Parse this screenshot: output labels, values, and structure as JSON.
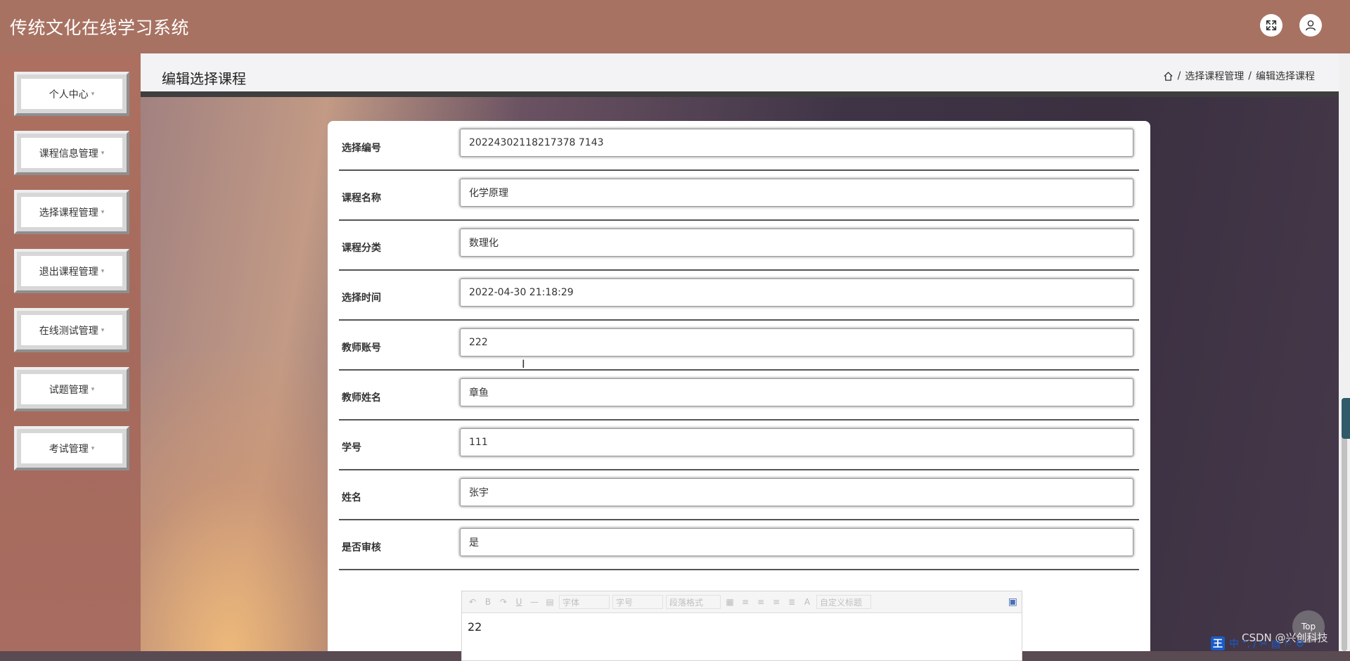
{
  "app": {
    "title": "传统文化在线学习系统"
  },
  "header": {
    "fullscreen_icon": "expand-icon",
    "user_icon": "user-icon"
  },
  "sidebar": {
    "items": [
      {
        "label": "个人中心"
      },
      {
        "label": "课程信息管理"
      },
      {
        "label": "选择课程管理"
      },
      {
        "label": "退出课程管理"
      },
      {
        "label": "在线测试管理"
      },
      {
        "label": "试题管理"
      },
      {
        "label": "考试管理"
      }
    ],
    "caret": "▾"
  },
  "page": {
    "title": "编辑选择课程",
    "breadcrumb": {
      "sep": "/",
      "item1": "选择课程管理",
      "item2": "编辑选择课程"
    }
  },
  "form": {
    "fields": [
      {
        "label": "选择编号",
        "value": "20224302118217378 7143"
      },
      {
        "label": "课程名称",
        "value": "化学原理"
      },
      {
        "label": "课程分类",
        "value": "数理化"
      },
      {
        "label": "选择时间",
        "value": "2022-04-30 21:18:29"
      },
      {
        "label": "教师账号",
        "value": "222"
      },
      {
        "label": "教师姓名",
        "value": "章鱼"
      },
      {
        "label": "学号",
        "value": "111"
      },
      {
        "label": "姓名",
        "value": "张宇"
      },
      {
        "label": "是否审核",
        "value": "是"
      }
    ]
  },
  "editor": {
    "toolbar": {
      "undo": "↶",
      "bold": "B",
      "redo": "↷",
      "underline": "U",
      "hr": "—",
      "doc": "▤",
      "font": "字体",
      "size": "字号",
      "paragraph": "段落格式",
      "table": "▦",
      "align_left": "≡",
      "align_center": "≡",
      "align_right": "≡",
      "justify": "≣",
      "color": "A",
      "custom_title": "自定义标题",
      "fullscreen": "▣"
    },
    "content": "22"
  },
  "overlay": {
    "top_button": "Top",
    "watermark": "CSDN @兴创科技",
    "ime_logo": "王",
    "ime_text": "中 °, ∕ ✂ ▤ ⚐ ⚙"
  }
}
